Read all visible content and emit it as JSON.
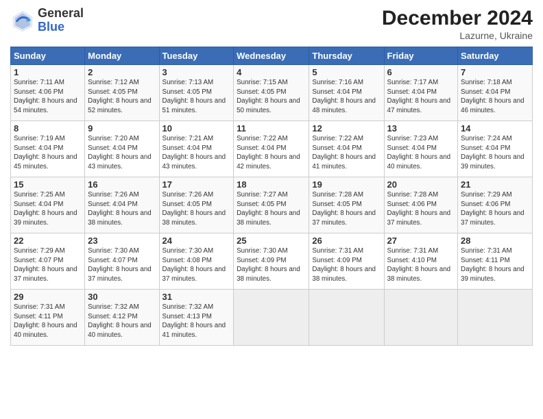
{
  "header": {
    "logo_general": "General",
    "logo_blue": "Blue",
    "month_title": "December 2024",
    "location": "Lazurne, Ukraine"
  },
  "days_of_week": [
    "Sunday",
    "Monday",
    "Tuesday",
    "Wednesday",
    "Thursday",
    "Friday",
    "Saturday"
  ],
  "weeks": [
    [
      {
        "day": "1",
        "info": "Sunrise: 7:11 AM\nSunset: 4:06 PM\nDaylight: 8 hours\nand 54 minutes."
      },
      {
        "day": "2",
        "info": "Sunrise: 7:12 AM\nSunset: 4:05 PM\nDaylight: 8 hours\nand 52 minutes."
      },
      {
        "day": "3",
        "info": "Sunrise: 7:13 AM\nSunset: 4:05 PM\nDaylight: 8 hours\nand 51 minutes."
      },
      {
        "day": "4",
        "info": "Sunrise: 7:15 AM\nSunset: 4:05 PM\nDaylight: 8 hours\nand 50 minutes."
      },
      {
        "day": "5",
        "info": "Sunrise: 7:16 AM\nSunset: 4:04 PM\nDaylight: 8 hours\nand 48 minutes."
      },
      {
        "day": "6",
        "info": "Sunrise: 7:17 AM\nSunset: 4:04 PM\nDaylight: 8 hours\nand 47 minutes."
      },
      {
        "day": "7",
        "info": "Sunrise: 7:18 AM\nSunset: 4:04 PM\nDaylight: 8 hours\nand 46 minutes."
      }
    ],
    [
      {
        "day": "8",
        "info": "Sunrise: 7:19 AM\nSunset: 4:04 PM\nDaylight: 8 hours\nand 45 minutes."
      },
      {
        "day": "9",
        "info": "Sunrise: 7:20 AM\nSunset: 4:04 PM\nDaylight: 8 hours\nand 43 minutes."
      },
      {
        "day": "10",
        "info": "Sunrise: 7:21 AM\nSunset: 4:04 PM\nDaylight: 8 hours\nand 43 minutes."
      },
      {
        "day": "11",
        "info": "Sunrise: 7:22 AM\nSunset: 4:04 PM\nDaylight: 8 hours\nand 42 minutes."
      },
      {
        "day": "12",
        "info": "Sunrise: 7:22 AM\nSunset: 4:04 PM\nDaylight: 8 hours\nand 41 minutes."
      },
      {
        "day": "13",
        "info": "Sunrise: 7:23 AM\nSunset: 4:04 PM\nDaylight: 8 hours\nand 40 minutes."
      },
      {
        "day": "14",
        "info": "Sunrise: 7:24 AM\nSunset: 4:04 PM\nDaylight: 8 hours\nand 39 minutes."
      }
    ],
    [
      {
        "day": "15",
        "info": "Sunrise: 7:25 AM\nSunset: 4:04 PM\nDaylight: 8 hours\nand 39 minutes."
      },
      {
        "day": "16",
        "info": "Sunrise: 7:26 AM\nSunset: 4:04 PM\nDaylight: 8 hours\nand 38 minutes."
      },
      {
        "day": "17",
        "info": "Sunrise: 7:26 AM\nSunset: 4:05 PM\nDaylight: 8 hours\nand 38 minutes."
      },
      {
        "day": "18",
        "info": "Sunrise: 7:27 AM\nSunset: 4:05 PM\nDaylight: 8 hours\nand 38 minutes."
      },
      {
        "day": "19",
        "info": "Sunrise: 7:28 AM\nSunset: 4:05 PM\nDaylight: 8 hours\nand 37 minutes."
      },
      {
        "day": "20",
        "info": "Sunrise: 7:28 AM\nSunset: 4:06 PM\nDaylight: 8 hours\nand 37 minutes."
      },
      {
        "day": "21",
        "info": "Sunrise: 7:29 AM\nSunset: 4:06 PM\nDaylight: 8 hours\nand 37 minutes."
      }
    ],
    [
      {
        "day": "22",
        "info": "Sunrise: 7:29 AM\nSunset: 4:07 PM\nDaylight: 8 hours\nand 37 minutes."
      },
      {
        "day": "23",
        "info": "Sunrise: 7:30 AM\nSunset: 4:07 PM\nDaylight: 8 hours\nand 37 minutes."
      },
      {
        "day": "24",
        "info": "Sunrise: 7:30 AM\nSunset: 4:08 PM\nDaylight: 8 hours\nand 37 minutes."
      },
      {
        "day": "25",
        "info": "Sunrise: 7:30 AM\nSunset: 4:09 PM\nDaylight: 8 hours\nand 38 minutes."
      },
      {
        "day": "26",
        "info": "Sunrise: 7:31 AM\nSunset: 4:09 PM\nDaylight: 8 hours\nand 38 minutes."
      },
      {
        "day": "27",
        "info": "Sunrise: 7:31 AM\nSunset: 4:10 PM\nDaylight: 8 hours\nand 38 minutes."
      },
      {
        "day": "28",
        "info": "Sunrise: 7:31 AM\nSunset: 4:11 PM\nDaylight: 8 hours\nand 39 minutes."
      }
    ],
    [
      {
        "day": "29",
        "info": "Sunrise: 7:31 AM\nSunset: 4:11 PM\nDaylight: 8 hours\nand 40 minutes."
      },
      {
        "day": "30",
        "info": "Sunrise: 7:32 AM\nSunset: 4:12 PM\nDaylight: 8 hours\nand 40 minutes."
      },
      {
        "day": "31",
        "info": "Sunrise: 7:32 AM\nSunset: 4:13 PM\nDaylight: 8 hours\nand 41 minutes."
      },
      {
        "day": "",
        "info": ""
      },
      {
        "day": "",
        "info": ""
      },
      {
        "day": "",
        "info": ""
      },
      {
        "day": "",
        "info": ""
      }
    ]
  ]
}
